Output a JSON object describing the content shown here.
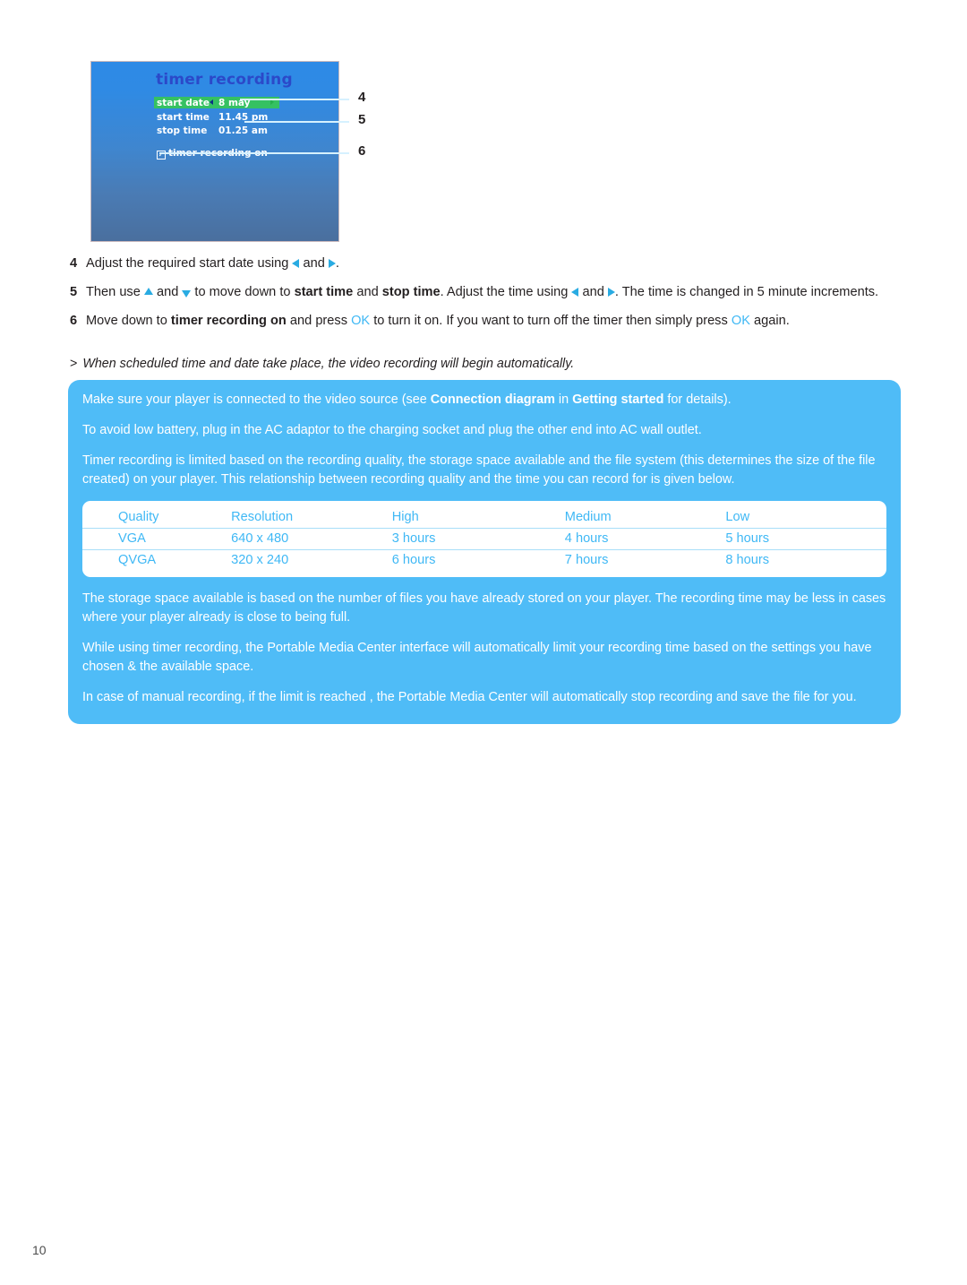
{
  "page": {
    "number": "10"
  },
  "figure": {
    "name": "timer-recording-screen",
    "title": "timer recording",
    "rows": [
      {
        "label": "start date",
        "value": "8 may"
      },
      {
        "label": "start time",
        "value": "11.45 pm"
      },
      {
        "label": "stop time",
        "value": "01.25 am"
      }
    ],
    "toggle": {
      "label": "timer recording on",
      "checkbox_glyph": "✓",
      "checked": true
    },
    "callouts": [
      {
        "number": "4",
        "points_to": "start date"
      },
      {
        "number": "5",
        "points_to": "stop time"
      },
      {
        "number": "6",
        "points_to": "timer recording on"
      }
    ],
    "colors": {
      "highlight_row": "#35c162",
      "screen_top": "#2e8ae6",
      "screen_bottom": "#4a6f9e",
      "title_text": "#2b49c9"
    }
  },
  "steps": [
    {
      "number": "4",
      "parts": [
        {
          "type": "text",
          "text": "Adjust the required start date using "
        },
        {
          "type": "icon",
          "icon": "triangle-left-icon"
        },
        {
          "type": "text",
          "text": " and "
        },
        {
          "type": "icon",
          "icon": "triangle-right-icon"
        },
        {
          "type": "text",
          "text": "."
        }
      ]
    },
    {
      "number": "5",
      "parts": [
        {
          "type": "text",
          "text": "Then use "
        },
        {
          "type": "icon",
          "icon": "triangle-up-icon"
        },
        {
          "type": "text",
          "text": " and "
        },
        {
          "type": "icon",
          "icon": "triangle-down-icon"
        },
        {
          "type": "text",
          "text": " to move down to "
        },
        {
          "type": "bold",
          "text": "start time"
        },
        {
          "type": "text",
          "text": " and "
        },
        {
          "type": "bold",
          "text": "stop time"
        },
        {
          "type": "text",
          "text": ". Adjust the time using "
        },
        {
          "type": "icon",
          "icon": "triangle-left-icon"
        },
        {
          "type": "text",
          "text": " and "
        },
        {
          "type": "icon",
          "icon": "triangle-right-icon"
        },
        {
          "type": "text",
          "text": ". The time is changed in 5 minute increments."
        }
      ]
    },
    {
      "number": "6",
      "parts": [
        {
          "type": "text",
          "text": "Move down to "
        },
        {
          "type": "bold",
          "text": "timer recording on"
        },
        {
          "type": "text",
          "text": " and press "
        },
        {
          "type": "key",
          "text": "OK"
        },
        {
          "type": "text",
          "text": " to turn it on. If you want to turn off the timer then simply press "
        },
        {
          "type": "key",
          "text": "OK"
        },
        {
          "type": "text",
          "text": " again."
        }
      ]
    }
  ],
  "note": {
    "marker": ">",
    "text": "When scheduled time and date take place, the video recording will begin automatically."
  },
  "info_panel": {
    "background_color": "#4fbcf7",
    "paragraph_1": {
      "a": "Make sure your player is connected to the video source (see ",
      "b1": "Connection diagram",
      "c": " in ",
      "b2": "Getting started",
      "d": " for details)."
    },
    "paragraph_2": "To avoid low battery, plug in the AC adaptor to the charging socket and plug the other end into AC wall outlet.",
    "paragraph_3": "Timer recording is limited based on the recording quality, the storage space available and the file system (this determines the size of the file created) on your player. This relationship between recording quality and the time you can record for is given below.",
    "paragraph_4": "The storage space available is based on the number of files you have already stored on your player. The recording time may be less in cases where your player already is close to being full.",
    "paragraph_5": "While using timer recording, the Portable Media Center interface will automatically limit your recording time based on the settings you have chosen & the available space.",
    "paragraph_6": "In case of manual recording, if the limit is reached , the Portable Media Center will automatically stop recording and save the file for you."
  },
  "recording_table": {
    "text_color": "#3fb8f5",
    "headers": [
      "Quality",
      "Resolution",
      "High",
      "Medium",
      "Low"
    ],
    "rows": [
      [
        "VGA",
        "640 x 480",
        "3 hours",
        "4 hours",
        "5 hours"
      ],
      [
        "QVGA",
        "320 x 240",
        "6 hours",
        "7 hours",
        "8 hours"
      ]
    ]
  }
}
